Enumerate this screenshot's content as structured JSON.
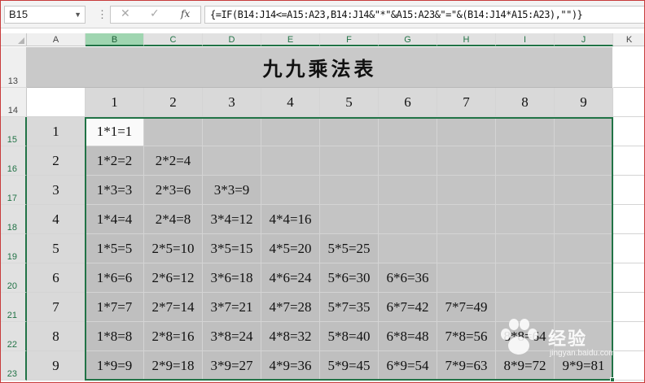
{
  "formula_bar": {
    "name_box": "B15",
    "cancel_icon": "✕",
    "enter_icon": "✓",
    "fx_label": "fx",
    "formula": "{=IF(B14:J14<=A15:A23,B14:J14&\"*\"&A15:A23&\"=\"&(B14:J14*A15:A23),\"\")}"
  },
  "column_headers": [
    "A",
    "B",
    "C",
    "D",
    "E",
    "F",
    "G",
    "H",
    "I",
    "J",
    "K"
  ],
  "row_headers": [
    "13",
    "14",
    "15",
    "16",
    "17",
    "18",
    "19",
    "20",
    "21",
    "22",
    "23"
  ],
  "title": "九九乘法表",
  "multipliers_row": [
    "1",
    "2",
    "3",
    "4",
    "5",
    "6",
    "7",
    "8",
    "9"
  ],
  "multipliers_col": [
    "1",
    "2",
    "3",
    "4",
    "5",
    "6",
    "7",
    "8",
    "9"
  ],
  "table": [
    [
      "1*1=1",
      "",
      "",
      "",
      "",
      "",
      "",
      "",
      ""
    ],
    [
      "1*2=2",
      "2*2=4",
      "",
      "",
      "",
      "",
      "",
      "",
      ""
    ],
    [
      "1*3=3",
      "2*3=6",
      "3*3=9",
      "",
      "",
      "",
      "",
      "",
      ""
    ],
    [
      "1*4=4",
      "2*4=8",
      "3*4=12",
      "4*4=16",
      "",
      "",
      "",
      "",
      ""
    ],
    [
      "1*5=5",
      "2*5=10",
      "3*5=15",
      "4*5=20",
      "5*5=25",
      "",
      "",
      "",
      ""
    ],
    [
      "1*6=6",
      "2*6=12",
      "3*6=18",
      "4*6=24",
      "5*6=30",
      "6*6=36",
      "",
      "",
      ""
    ],
    [
      "1*7=7",
      "2*7=14",
      "3*7=21",
      "4*7=28",
      "5*7=35",
      "6*7=42",
      "7*7=49",
      "",
      ""
    ],
    [
      "1*8=8",
      "2*8=16",
      "3*8=24",
      "4*8=32",
      "5*8=40",
      "6*8=48",
      "7*8=56",
      "8*8=64",
      ""
    ],
    [
      "1*9=9",
      "2*9=18",
      "3*9=27",
      "4*9=36",
      "5*9=45",
      "6*9=54",
      "7*9=63",
      "8*9=72",
      "9*9=81"
    ]
  ],
  "watermark": {
    "text": "经验",
    "sub": "jingyan.baidu.com"
  },
  "colors": {
    "accent": "#217346",
    "cell_fill": "#bfbfbf",
    "header_fill": "#d9d9d9",
    "title_fill": "#c9c9c9"
  }
}
